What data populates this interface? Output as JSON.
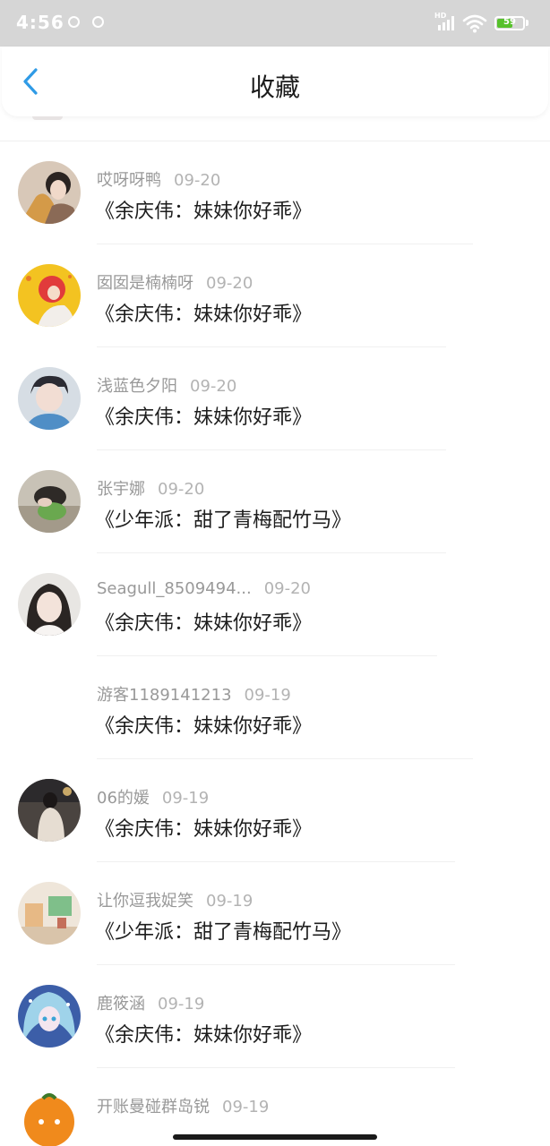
{
  "status_bar": {
    "time": "4:56",
    "network": "HD",
    "battery_level": "59",
    "battery_color": "#56c12b"
  },
  "header": {
    "title": "收藏",
    "back_icon": "chevron-left-icon",
    "accent_color": "#2f9be6"
  },
  "favorites": [
    {
      "name": "哎呀呀鸭",
      "date": "09-20",
      "work": "《余庆伟：妹妹你好乖》",
      "avatar": "photo"
    },
    {
      "name": "囡囡是楠楠呀",
      "date": "09-20",
      "work": "《余庆伟：妹妹你好乖》",
      "avatar": "photo"
    },
    {
      "name": "浅蓝色夕阳",
      "date": "09-20",
      "work": "《余庆伟：妹妹你好乖》",
      "avatar": "photo"
    },
    {
      "name": "张宇娜",
      "date": "09-20",
      "work": "《少年派：甜了青梅配竹马》",
      "avatar": "photo"
    },
    {
      "name": "Seagull_8509494...",
      "date": "09-20",
      "work": "《余庆伟：妹妹你好乖》",
      "avatar": "photo"
    },
    {
      "name": "游客1189141213",
      "date": "09-19",
      "work": "《余庆伟：妹妹你好乖》",
      "avatar": "none"
    },
    {
      "name": "06的媛",
      "date": "09-19",
      "work": "《余庆伟：妹妹你好乖》",
      "avatar": "photo"
    },
    {
      "name": "让你逗我娖笑",
      "date": "09-19",
      "work": "《少年派：甜了青梅配竹马》",
      "avatar": "photo"
    },
    {
      "name": "鹿筱涵",
      "date": "09-19",
      "work": "《余庆伟：妹妹你好乖》",
      "avatar": "photo"
    },
    {
      "name": "开账曼碰群岛锐",
      "date": "09-19",
      "work": "",
      "avatar": "photo"
    }
  ]
}
